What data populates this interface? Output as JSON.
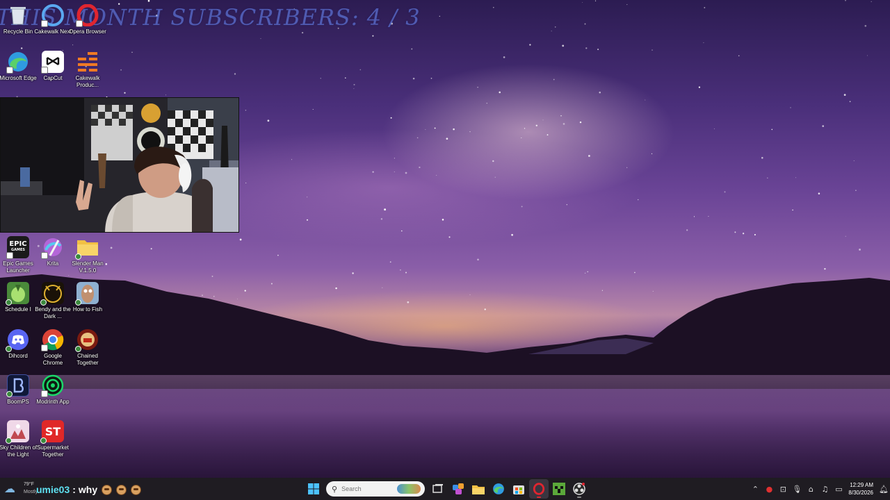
{
  "overlay": {
    "subscribers_text": "THIS MONTH SUBSCRIBERS: 4 / 3"
  },
  "desktop_icons": [
    {
      "id": "recycle-bin",
      "label": "Recycle Bin",
      "icon": "recycle-bin-icon"
    },
    {
      "id": "cakewalk-next",
      "label": "Cakewalk Next",
      "icon": "cakewalk-next-icon"
    },
    {
      "id": "opera-browser",
      "label": "Opera Browser",
      "icon": "opera-icon"
    },
    {
      "id": "microsoft-edge",
      "label": "Microsoft Edge",
      "icon": "edge-icon"
    },
    {
      "id": "capcut",
      "label": "CapCut",
      "icon": "capcut-icon"
    },
    {
      "id": "cakewalk-producer",
      "label": "Cakewalk Produc...",
      "icon": "cakewalk-producer-icon"
    },
    {
      "id": "epic-games",
      "label": "Epic Games Launcher",
      "icon": "epic-games-icon",
      "icon_text": "EPIC\nGAMES"
    },
    {
      "id": "krita",
      "label": "Krita",
      "icon": "krita-icon"
    },
    {
      "id": "slender-man",
      "label": "Slender Man V.1.5.0",
      "icon": "folder-icon"
    },
    {
      "id": "schedule-i",
      "label": "Schedule I",
      "icon": "schedule-i-icon"
    },
    {
      "id": "bendy",
      "label": "Bendy and the Dark ...",
      "icon": "bendy-icon"
    },
    {
      "id": "how-to-fish",
      "label": "How to Fish",
      "icon": "how-to-fish-icon"
    },
    {
      "id": "dihcord",
      "label": "Dihcord",
      "icon": "discord-icon"
    },
    {
      "id": "google-chrome",
      "label": "Google Chrome",
      "icon": "chrome-icon"
    },
    {
      "id": "chained-together",
      "label": "Chained Together",
      "icon": "chained-together-icon"
    },
    {
      "id": "boomps",
      "label": "BoomPS",
      "icon": "boomps-icon"
    },
    {
      "id": "modrinth",
      "label": "Modrinth App",
      "icon": "modrinth-icon"
    },
    {
      "id": "sky",
      "label": "Sky Children of the Light",
      "icon": "sky-icon"
    },
    {
      "id": "supermarket-together",
      "label": "Supermarket Together",
      "icon": "supermarket-together-icon",
      "icon_text": "ST"
    }
  ],
  "taskbar": {
    "weather": {
      "temp": "79°F",
      "desc": "Mostly..."
    },
    "chat": {
      "user": "umie03",
      "separator": ":",
      "message": "why"
    },
    "search_placeholder": "Search",
    "pinned": [
      {
        "id": "start",
        "icon": "windows-start-icon"
      },
      {
        "id": "task-view",
        "icon": "task-view-icon"
      },
      {
        "id": "widgets",
        "icon": "widgets-icon"
      },
      {
        "id": "file-explorer",
        "icon": "folder-icon"
      },
      {
        "id": "edge",
        "icon": "edge-icon"
      },
      {
        "id": "store",
        "icon": "store-icon"
      },
      {
        "id": "opera",
        "icon": "opera-icon"
      },
      {
        "id": "minecraft",
        "icon": "minecraft-icon"
      },
      {
        "id": "obs",
        "icon": "obs-icon"
      }
    ],
    "tray": {
      "time": "12:29 AM",
      "date": "8/30/2026"
    }
  },
  "colors": {
    "taskbar_bg": "#1f1c22",
    "chat_user": "#5ee0f0",
    "overlay_text": "#5a6fd0"
  }
}
